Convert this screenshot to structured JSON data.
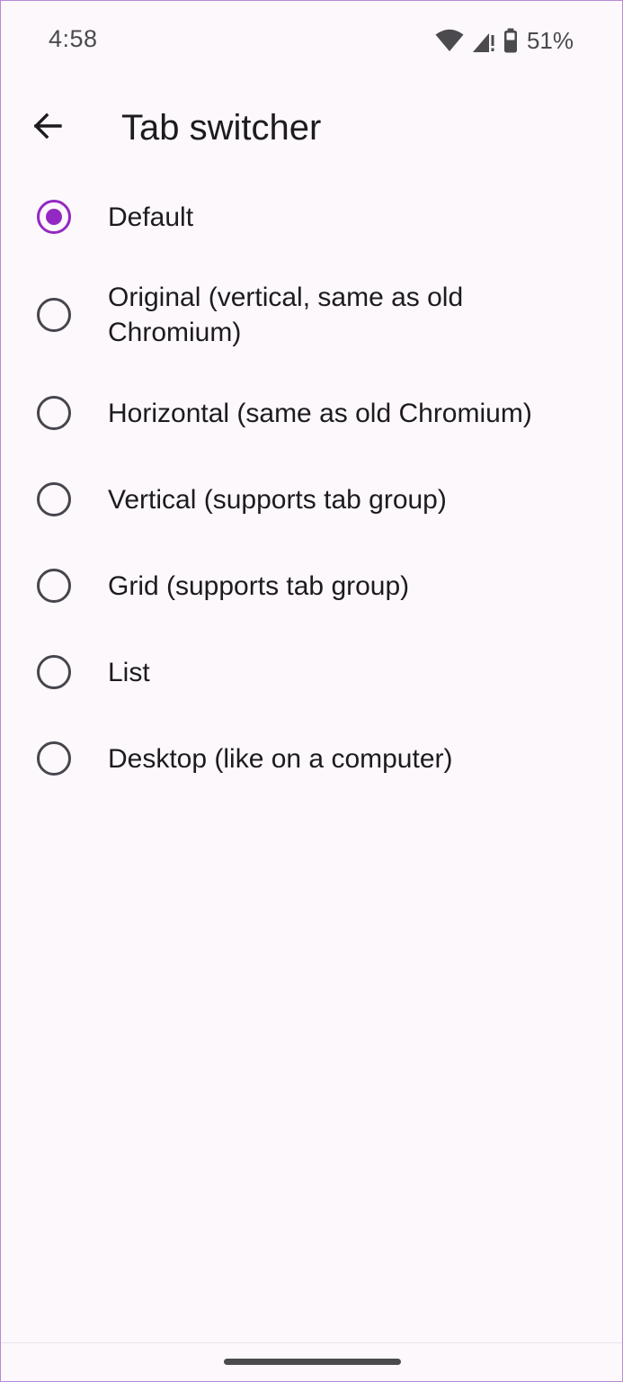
{
  "status_bar": {
    "time": "4:58",
    "battery_percent": "51%",
    "icons": [
      "wifi-icon",
      "cell-signal-icon",
      "battery-icon"
    ]
  },
  "app_bar": {
    "back_icon": "arrow-left-icon",
    "title": "Tab switcher"
  },
  "options": [
    {
      "label": "Default",
      "selected": true
    },
    {
      "label": "Original (vertical, same as old Chromium)",
      "selected": false
    },
    {
      "label": "Horizontal (same as old Chromium)",
      "selected": false
    },
    {
      "label": "Vertical (supports tab group)",
      "selected": false
    },
    {
      "label": "Grid (supports tab group)",
      "selected": false
    },
    {
      "label": "List",
      "selected": false
    },
    {
      "label": "Desktop (like on a computer)",
      "selected": false
    }
  ],
  "colors": {
    "accent": "#9328C2",
    "background": "#FDF8FC",
    "text": "#1D1B20",
    "radio_unselected": "#47454D"
  }
}
